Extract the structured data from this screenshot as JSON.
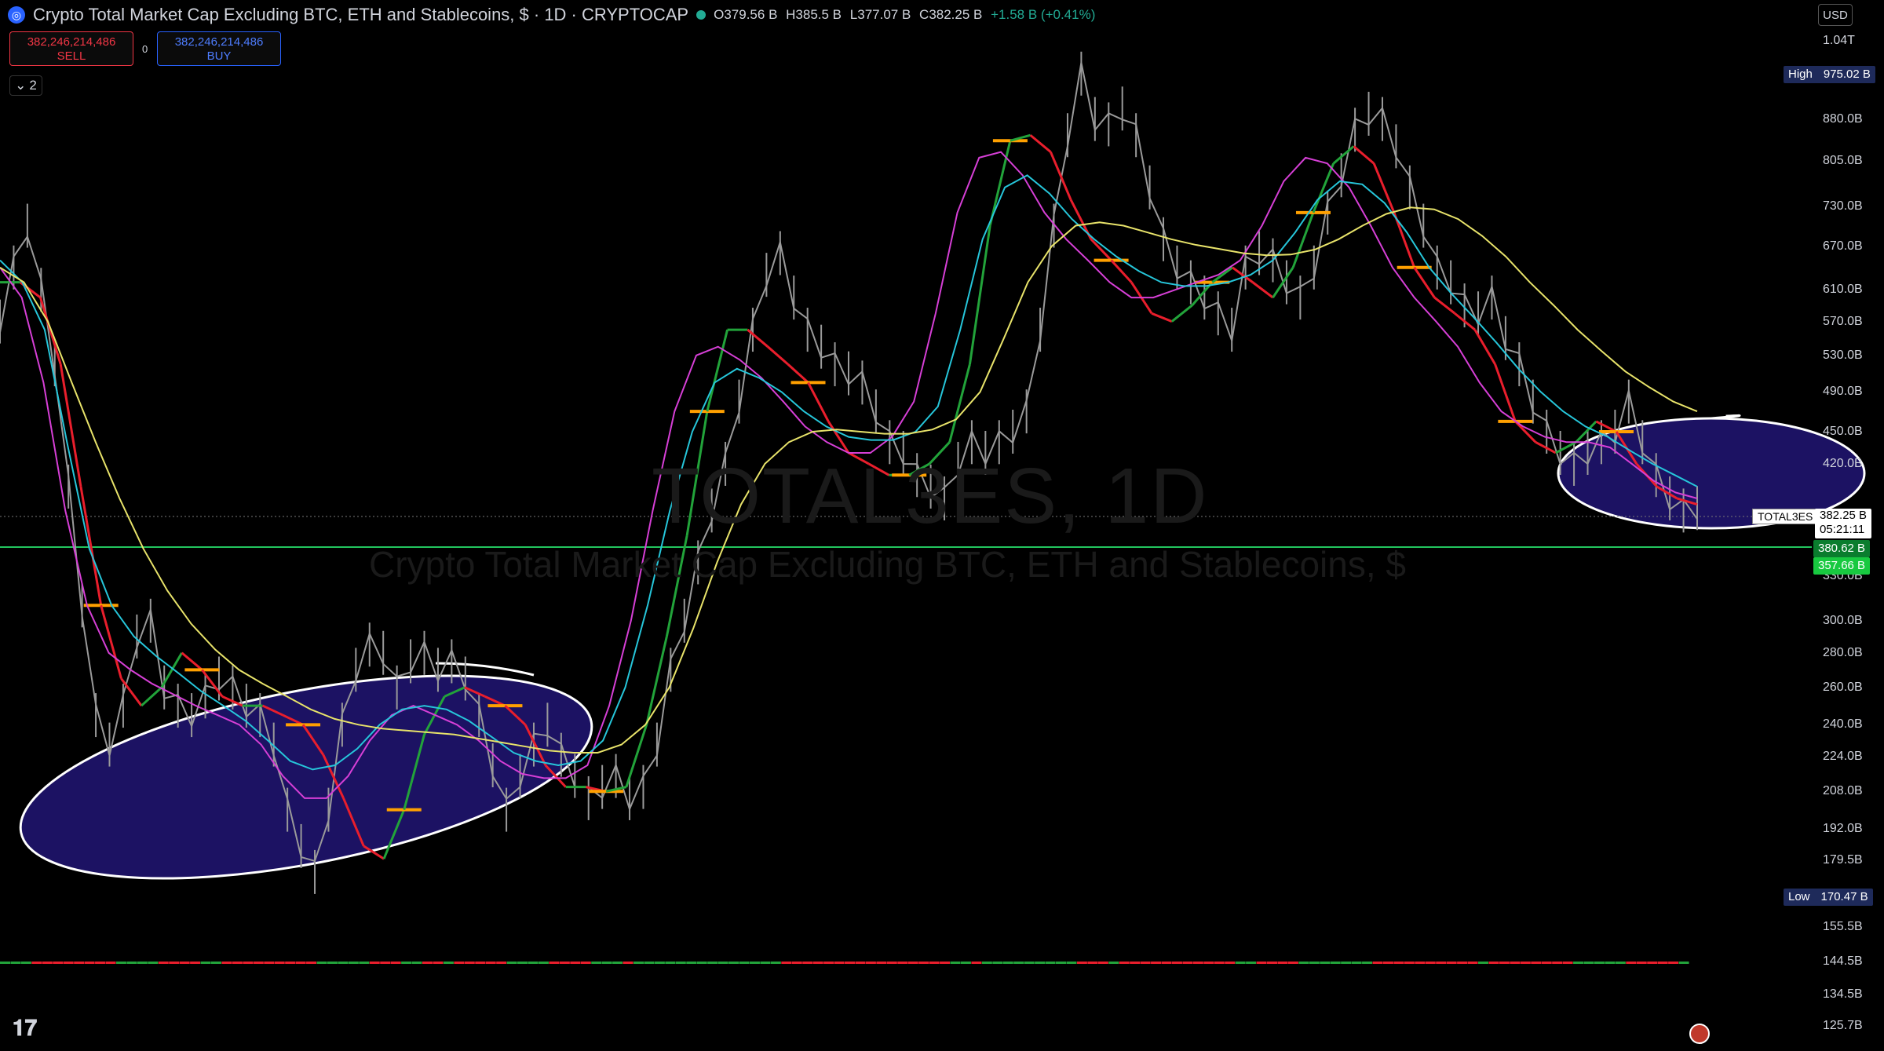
{
  "header": {
    "title": "Crypto Total Market Cap Excluding BTC, ETH and Stablecoins, $ · 1D · CRYPTOCAP",
    "ohlc": [
      {
        "k": "O",
        "v": "379.56 B"
      },
      {
        "k": "H",
        "v": "385.5 B"
      },
      {
        "k": "L",
        "v": "377.07 B"
      },
      {
        "k": "C",
        "v": "382.25 B"
      }
    ],
    "change": "+1.58 B (+0.41%)"
  },
  "trade": {
    "sell_price": "382,246,214,486",
    "sell_label": "SELL",
    "buy_price": "382,246,214,486",
    "buy_label": "BUY",
    "spread": "0"
  },
  "indicators_toggle": "2",
  "currency": "USD",
  "watermark": {
    "symbol": "TOTAL3ES, 1D",
    "description": "Crypto Total Market Cap Excluding BTC, ETH and Stablecoins, $"
  },
  "price_axis": {
    "ticks": [
      "1.04T",
      "880.0B",
      "805.0B",
      "730.0B",
      "670.0B",
      "610.0B",
      "570.0B",
      "530.0B",
      "490.0B",
      "450.0B",
      "420.0B",
      "330.0B",
      "300.0B",
      "280.0B",
      "260.0B",
      "240.0B",
      "224.0B",
      "208.0B",
      "192.0B",
      "179.5B",
      "155.5B",
      "144.5B",
      "134.5B",
      "125.7B"
    ],
    "high_label": "High",
    "high_value": "975.02 B",
    "low_label": "Low",
    "low_value": "170.47 B",
    "symbol_tag": "TOTAL3ES",
    "last_price": "382.25 B",
    "countdown": "05:21:11",
    "level_1": "380.62 B",
    "level_2": "357.66 B"
  },
  "colors": {
    "price": "#9a9a9a",
    "ema_fast": "#e91e2c",
    "ema_fast_up": "#22a33a",
    "ema_mid": "#d63fd6",
    "ema_slow": "#26c6da",
    "ema_long": "#e8e36a",
    "hl_level": "#ffa000",
    "ellipse_fill": "#1c1263",
    "ellipse_stroke": "#ffffff",
    "support_line": "#22c55e"
  },
  "chart_data": {
    "type": "line",
    "title": "Crypto Total Market Cap Excluding BTC, ETH and Stablecoins, $",
    "timeframe": "1D",
    "yscale": "log",
    "ylim": [
      120,
      1080
    ],
    "series": [
      {
        "values": [
          570,
          640,
          700,
          610,
          520,
          400,
          310,
          245,
          230,
          250,
          290,
          300,
          260,
          250,
          245,
          255,
          265,
          260,
          250,
          245,
          230,
          200,
          185,
          175,
          200,
          240,
          270,
          285,
          280,
          260,
          275,
          280,
          270,
          275,
          265,
          245,
          220,
          200,
          215,
          230,
          240,
          225,
          215,
          205,
          210,
          215,
          205,
          210,
          230,
          270,
          300,
          340,
          380,
          420,
          480,
          560,
          630,
          660,
          600,
          560,
          540,
          520,
          510,
          500,
          470,
          440,
          430,
          410,
          400,
          390,
          420,
          440,
          430,
          440,
          450,
          470,
          560,
          700,
          850,
          970,
          880,
          870,
          900,
          850,
          760,
          680,
          640,
          620,
          600,
          580,
          560,
          640,
          660,
          650,
          620,
          600,
          640,
          720,
          780,
          860,
          890,
          880,
          830,
          760,
          700,
          640,
          620,
          590,
          580,
          600,
          550,
          520,
          480,
          450,
          430,
          420,
          430,
          440,
          450,
          480,
          440,
          410,
          390,
          380,
          382
        ]
      },
      {
        "values": [
          620,
          620,
          600,
          520,
          400,
          310,
          265,
          250,
          260,
          280,
          270,
          255,
          250,
          250,
          245,
          240,
          225,
          205,
          185,
          180,
          200,
          235,
          255,
          260,
          255,
          250,
          240,
          220,
          210,
          210,
          208,
          210,
          240,
          290,
          360,
          470,
          560,
          560,
          540,
          520,
          500,
          460,
          430,
          420,
          410,
          410,
          420,
          440,
          520,
          700,
          840,
          850,
          820,
          740,
          680,
          650,
          620,
          580,
          570,
          590,
          620,
          640,
          620,
          600,
          640,
          720,
          800,
          830,
          800,
          720,
          640,
          600,
          580,
          560,
          520,
          460,
          440,
          430,
          440,
          460,
          450,
          420,
          400,
          390,
          385
        ]
      },
      {
        "values": [
          640,
          600,
          500,
          380,
          310,
          280,
          270,
          262,
          256,
          250,
          245,
          240,
          230,
          215,
          205,
          205,
          215,
          232,
          245,
          250,
          245,
          240,
          232,
          222,
          216,
          214,
          214,
          220,
          250,
          300,
          380,
          470,
          530,
          540,
          525,
          505,
          480,
          455,
          440,
          430,
          430,
          445,
          480,
          580,
          720,
          810,
          820,
          780,
          720,
          680,
          650,
          620,
          600,
          600,
          610,
          620,
          630,
          650,
          700,
          770,
          810,
          800,
          760,
          700,
          640,
          600,
          570,
          540,
          500,
          470,
          455,
          445,
          440,
          440,
          435,
          420,
          405,
          395,
          390
        ]
      },
      {
        "values": [
          650,
          620,
          560,
          440,
          350,
          310,
          290,
          278,
          268,
          258,
          250,
          242,
          232,
          222,
          218,
          220,
          228,
          240,
          248,
          250,
          248,
          242,
          234,
          226,
          222,
          220,
          222,
          232,
          260,
          310,
          380,
          450,
          500,
          515,
          505,
          490,
          470,
          455,
          445,
          442,
          442,
          450,
          475,
          560,
          680,
          760,
          780,
          750,
          710,
          680,
          655,
          635,
          620,
          615,
          615,
          620,
          630,
          650,
          690,
          740,
          770,
          765,
          735,
          690,
          640,
          605,
          575,
          545,
          515,
          490,
          470,
          455,
          445,
          432,
          420,
          410,
          400
        ]
      },
      {
        "values": [
          640,
          620,
          570,
          500,
          440,
          390,
          350,
          320,
          298,
          282,
          270,
          262,
          255,
          248,
          243,
          240,
          238,
          237,
          236,
          235,
          233,
          231,
          229,
          227,
          226,
          226,
          230,
          240,
          260,
          295,
          340,
          385,
          420,
          440,
          450,
          452,
          450,
          448,
          448,
          452,
          462,
          490,
          550,
          620,
          670,
          700,
          705,
          700,
          690,
          680,
          672,
          666,
          660,
          657,
          658,
          665,
          680,
          700,
          718,
          728,
          725,
          710,
          685,
          655,
          620,
          590,
          560,
          535,
          512,
          495,
          480,
          470
        ]
      }
    ],
    "annotations": [
      "High 975.02 B",
      "Low 170.47 B",
      "TOTAL3ES 382.25 B",
      "380.62 B",
      "357.66 B"
    ]
  }
}
